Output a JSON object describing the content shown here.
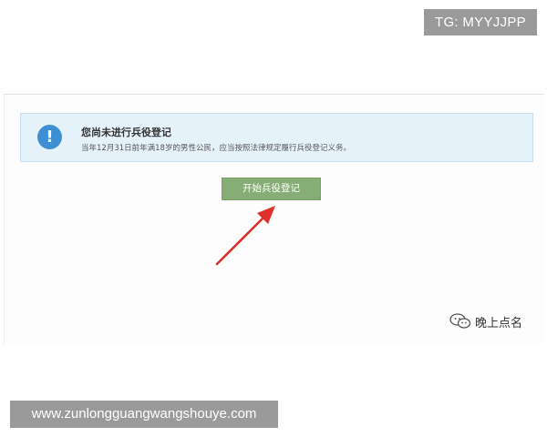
{
  "overlay": {
    "tg_label": "TG: MYYJJPP",
    "url_label": "www.zunlongguangwangshouye.com"
  },
  "notice": {
    "icon": "exclamation-icon",
    "icon_glyph": "!",
    "title": "您尚未进行兵役登记",
    "description": "当年12月31日前年满18岁的男性公民，应当按照法律规定履行兵役登记义务。"
  },
  "actions": {
    "start_label": "开始兵役登记"
  },
  "watermark": {
    "icon": "wechat-icon",
    "label": "晚上点名"
  },
  "colors": {
    "notice_bg": "#e6f2fa",
    "info_icon": "#3d8fd3",
    "button_bg": "#87ad77",
    "arrow": "#e0302a",
    "badge_bg": "#9a9a9a"
  }
}
